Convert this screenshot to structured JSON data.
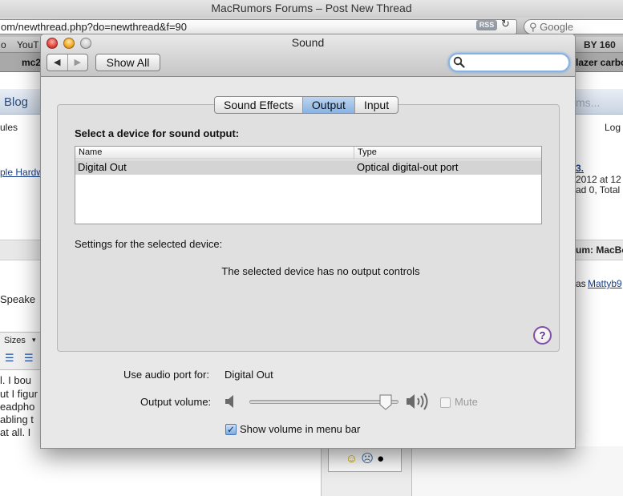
{
  "browser": {
    "title": "MacRumors Forums – Post New Thread",
    "url": "om/newthread.php?do=newthread&f=90",
    "rss_badge": "RSS",
    "google_placeholder": "Google",
    "bookmarks": [
      "o",
      "YouT",
      "BY 160"
    ],
    "tab_left": "mc2",
    "tab_right": "lazer carbo",
    "page": {
      "blog": "Blog",
      "rules": "ules",
      "ms": "ms...",
      "log": "Log",
      "apple_hardware": "ple Hardw",
      "link_3": "3.",
      "line_2012": "2012 at 12",
      "line_ad0": "ad 0, Total",
      "um_macbo": "um: MacBo",
      "as_mattyb": "as",
      "mattyb": "Mattyb9",
      "speaker": "Speake",
      "sizes": "Sizes",
      "body_lines": [
        "l.  I bou",
        "ut I figur",
        "eadpho",
        "abling t",
        "at all.  I"
      ]
    }
  },
  "sound": {
    "title": "Sound",
    "show_all": "Show All",
    "tabs": [
      "Sound Effects",
      "Output",
      "Input"
    ],
    "active_tab": 1,
    "device_heading": "Select a device for sound output:",
    "table": {
      "columns": [
        "Name",
        "Type"
      ],
      "rows": [
        {
          "name": "Digital Out",
          "type": "Optical digital-out port"
        }
      ]
    },
    "settings_label": "Settings for the selected device:",
    "no_controls": "The selected device has no output controls",
    "help": "?",
    "use_port_label": "Use audio port for:",
    "use_port_value": "Digital Out",
    "volume_label": "Output volume:",
    "volume_level": 0.95,
    "mute_label": "Mute",
    "mute_checked": false,
    "show_in_menubar_label": "Show volume in menu bar",
    "show_in_menubar_checked": true
  },
  "colors": {
    "active_tab": "#8ab2e2",
    "help_ring": "#7f4fa7",
    "search_focus": "#86b3e6"
  },
  "icons": [
    "close-icon",
    "minimize-icon",
    "zoom-icon",
    "back-arrow-icon",
    "forward-arrow-icon",
    "search-icon",
    "speaker-low-icon",
    "speaker-high-icon",
    "help-icon",
    "checkmark-icon",
    "smiley-icon",
    "sad-icon",
    "apple-icon",
    "reload-icon"
  ]
}
